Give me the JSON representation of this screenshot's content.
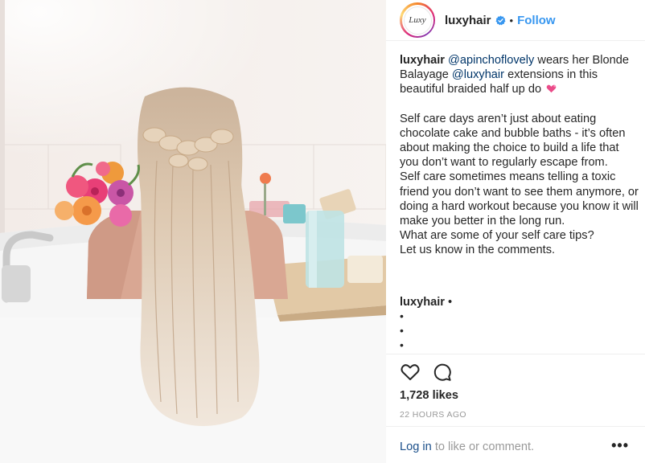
{
  "post": {
    "username": "luxyhair",
    "follow_label": "Follow",
    "separator": "•",
    "avatar_text": "Luxy"
  },
  "caption": {
    "username": "luxyhair",
    "mention1": "@apinchoflovely",
    "text1": " wears her Blonde Balayage ",
    "mention2": "@luxyhair",
    "text2": " extensions in this beautiful braided half up do ",
    "para2": "Self care days aren’t just about eating chocolate cake and bubble baths - it’s often about making the choice to build a life that you don’t want to regularly escape from.",
    "para3": "Self care sometimes means telling a toxic friend you don’t want to see them anymore, or doing a hard workout because you know it will make you better in the long run.",
    "para4": "What are some of your self care tips?",
    "para5": "Let us know in the comments."
  },
  "comment": {
    "username": "luxyhair",
    "suffix": " •",
    "bullets": [
      "•",
      "•",
      "•"
    ]
  },
  "stats": {
    "likes": "1,728 likes",
    "time": "22 HOURS AGO"
  },
  "footer": {
    "login_label": "Log in",
    "rest": " to like or comment.",
    "more_label": "•••"
  },
  "colors": {
    "link": "#3897f0",
    "mention": "#003569",
    "text": "#262626",
    "muted": "#999999",
    "verified": "#3897f0"
  },
  "icons": {
    "verified": "verified-badge-icon",
    "heart": "heart-icon",
    "comment": "comment-bubble-icon",
    "more": "more-options-icon",
    "emoji": "pink-hearts-emoji"
  }
}
